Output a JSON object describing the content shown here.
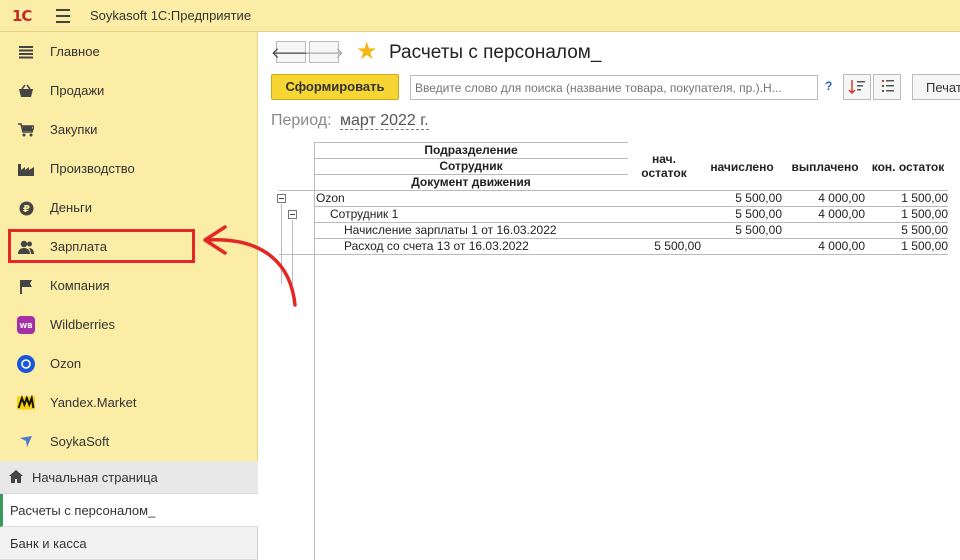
{
  "app": {
    "logo": "1C",
    "title": "Soykasoft 1С:Предприятие"
  },
  "sidebar": {
    "items": [
      {
        "label": "Главное",
        "icon": "menu-lines-icon"
      },
      {
        "label": "Продажи",
        "icon": "basket-icon"
      },
      {
        "label": "Закупки",
        "icon": "cart-icon"
      },
      {
        "label": "Производство",
        "icon": "factory-icon"
      },
      {
        "label": "Деньги",
        "icon": "ruble-coin-icon"
      },
      {
        "label": "Зарплата",
        "icon": "people-icon"
      },
      {
        "label": "Компания",
        "icon": "flag-icon"
      },
      {
        "label": "Wildberries",
        "icon": "wildberries-logo-icon",
        "badge": "WB"
      },
      {
        "label": "Ozon",
        "icon": "ozon-logo-icon"
      },
      {
        "label": "Yandex.Market",
        "icon": "yandex-market-logo-icon"
      },
      {
        "label": "SoykaSoft",
        "icon": "soykasoft-logo-icon"
      }
    ]
  },
  "bottom_nav": {
    "home": "Начальная страница",
    "open_form": "Расчеты с персоналом_",
    "bank": "Банк и касса"
  },
  "form": {
    "title": "Расчеты с персоналом_",
    "generate_button": "Сформировать",
    "search_placeholder": "Введите слово для поиска (название товара, покупателя, пр.).Н...",
    "help": "?",
    "print_button": "Печать",
    "period_label": "Период:",
    "period_value": "март 2022 г."
  },
  "report": {
    "headers": {
      "grouping": [
        "Подразделение",
        "Сотрудник",
        "Документ движения"
      ],
      "opening": [
        "нач.",
        "остаток"
      ],
      "accrued": "начислено",
      "paid": "выплачено",
      "closing": "кон. остаток"
    },
    "rows": [
      {
        "name": "Ozon",
        "opening": "",
        "accrued": "5 500,00",
        "paid": "4 000,00",
        "closing": "1 500,00"
      },
      {
        "name": "Сотрудник 1",
        "opening": "",
        "accrued": "5 500,00",
        "paid": "4 000,00",
        "closing": "1 500,00"
      },
      {
        "name": "Начисление зарплаты 1 от 16.03.2022",
        "opening": "",
        "accrued": "5 500,00",
        "paid": "",
        "closing": "5 500,00"
      },
      {
        "name": "Расход со счета 13  от 16.03.2022",
        "opening": "5 500,00",
        "accrued": "",
        "paid": "4 000,00",
        "closing": "1 500,00"
      }
    ]
  },
  "colors": {
    "sidebar_bg": "#fbeda5",
    "accent_button": "#f7d633",
    "highlight": "#e32626",
    "star": "#f2b615"
  }
}
